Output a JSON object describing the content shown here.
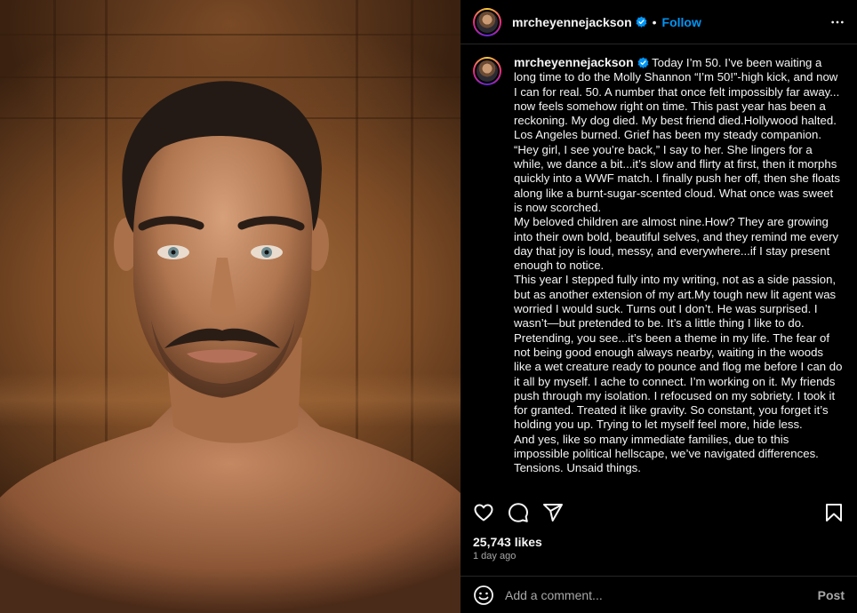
{
  "post": {
    "username": "mrcheyennejackson",
    "verified": true,
    "follow_label": "Follow",
    "dot": "•",
    "caption_paragraphs": [
      "Today I’m 50. I’ve been waiting a long time to do the Molly Shannon “I’m 50!”-high kick, and now I can for real. 50. A number that once felt impossibly far away... now feels somehow right on time. This past year has been a reckoning. My dog died. My best friend died.Hollywood halted. Los Angeles burned. Grief has been my steady companion. “Hey girl, I see you’re back,” I say to her. She lingers for a while, we dance a bit...it’s slow and flirty at first, then it morphs quickly into a WWF match. I finally push her off, then she floats along like a burnt-sugar-scented cloud. What once was sweet is now scorched.",
      "My beloved children are almost nine.How? They are growing into their own bold, beautiful selves, and they remind me every day that joy is loud, messy, and everywhere...if I stay present enough to notice.",
      "This year I stepped fully into my writing, not as a side passion, but as another extension of my art.My tough new lit agent was worried I would suck. Turns out I don’t. He was surprised. I wasn’t—but pretended to be. It’s a little thing I like to do. Pretending, you see...it’s been a theme in my life. The fear of not being good enough always nearby, waiting in the woods like a wet creature ready to pounce and flog me before I can do it all by myself. I ache to connect. I’m working on it. My friends push through my isolation. I refocused on my sobriety. I took it for granted. Treated it like gravity. So constant, you forget it’s holding you up. Trying to let myself feel more, hide less.",
      "And yes, like so many immediate families, due to this impossible political hellscape, we’ve navigated differences. Tensions. Unsaid things."
    ],
    "likes": "25,743 likes",
    "timestamp": "1 day ago"
  },
  "comment_box": {
    "placeholder": "Add a comment...",
    "post_label": "Post"
  },
  "icons": {
    "more": "more-horizontal-icon",
    "heart": "heart-icon",
    "comment": "comment-bubble-icon",
    "share": "paper-plane-icon",
    "save": "bookmark-icon",
    "emoji": "emoji-smiley-icon",
    "verified": "verified-badge-icon"
  },
  "colors": {
    "background": "#000000",
    "text": "#f5f5f5",
    "follow_blue": "#0095f6",
    "muted": "#a8a8a8",
    "verified_blue": "#0095f6"
  }
}
